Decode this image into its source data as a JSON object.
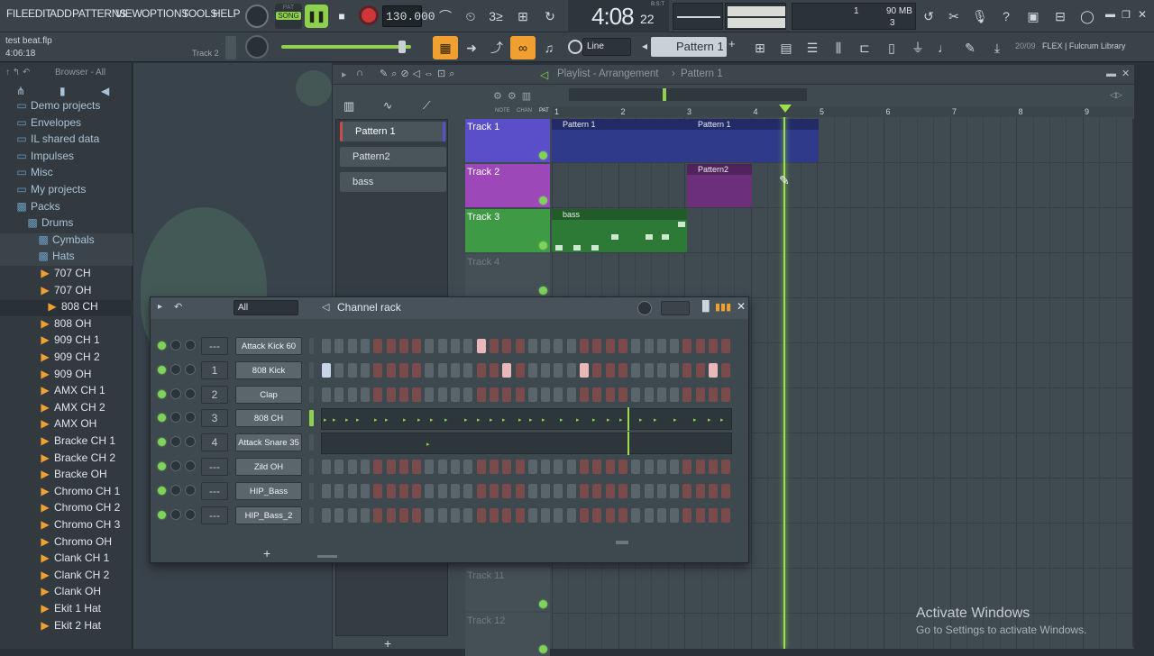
{
  "menu": [
    "FILE",
    "EDIT",
    "ADD",
    "PATTERNS",
    "VIEW",
    "OPTIONS",
    "TOOLS",
    "HELP"
  ],
  "transport": {
    "mode_pat": "PAT",
    "mode_song": "SONG",
    "tempo": "130.000",
    "time": "4:08",
    "time_sub": "22",
    "time_label": "B:S:T"
  },
  "cpu": {
    "channels": "1",
    "memory": "90 MB",
    "polyphony": "3"
  },
  "project": {
    "filename": "test beat.flp",
    "position": "4:06:18",
    "hint_track": "Track 2"
  },
  "toolbar2": {
    "snap": "Line",
    "pattern": "Pattern 1",
    "plus": "+",
    "news": "20/09",
    "news_text": "FLEX | Fulcrum Library"
  },
  "browser": {
    "title": "Browser - All",
    "items": [
      {
        "label": "Demo projects",
        "type": "folder"
      },
      {
        "label": "Envelopes",
        "type": "folder"
      },
      {
        "label": "IL shared data",
        "type": "folder"
      },
      {
        "label": "Impulses",
        "type": "folder"
      },
      {
        "label": "Misc",
        "type": "folder"
      },
      {
        "label": "My projects",
        "type": "folder"
      },
      {
        "label": "Packs",
        "type": "pack"
      },
      {
        "label": "Drums",
        "type": "pack"
      },
      {
        "label": "Cymbals",
        "type": "pack"
      },
      {
        "label": "Hats",
        "type": "pack"
      },
      {
        "label": "707 CH",
        "type": "sample"
      },
      {
        "label": "707 OH",
        "type": "sample"
      },
      {
        "label": "808 CH",
        "type": "sample"
      },
      {
        "label": "808 OH",
        "type": "sample"
      },
      {
        "label": "909 CH 1",
        "type": "sample"
      },
      {
        "label": "909 CH 2",
        "type": "sample"
      },
      {
        "label": "909 OH",
        "type": "sample"
      },
      {
        "label": "AMX CH 1",
        "type": "sample"
      },
      {
        "label": "AMX CH 2",
        "type": "sample"
      },
      {
        "label": "AMX OH",
        "type": "sample"
      },
      {
        "label": "Bracke CH 1",
        "type": "sample"
      },
      {
        "label": "Bracke CH 2",
        "type": "sample"
      },
      {
        "label": "Bracke OH",
        "type": "sample"
      },
      {
        "label": "Chromo CH 1",
        "type": "sample"
      },
      {
        "label": "Chromo CH 2",
        "type": "sample"
      },
      {
        "label": "Chromo CH 3",
        "type": "sample"
      },
      {
        "label": "Chromo OH",
        "type": "sample"
      },
      {
        "label": "Clank CH 1",
        "type": "sample"
      },
      {
        "label": "Clank CH 2",
        "type": "sample"
      },
      {
        "label": "Clank OH",
        "type": "sample"
      },
      {
        "label": "Ekit 1 Hat",
        "type": "sample"
      },
      {
        "label": "Ekit 2 Hat",
        "type": "sample"
      }
    ]
  },
  "playlist": {
    "title": "Playlist - Arrangement",
    "pattern": "Pattern 1",
    "pattern_list": [
      "Pattern 1",
      "Pattern2",
      "bass"
    ],
    "tabs": [
      "NOTE",
      "CHAN",
      "PAT"
    ],
    "bars": [
      "1",
      "2",
      "3",
      "4",
      "5",
      "6",
      "7",
      "8",
      "9"
    ],
    "tracks": [
      {
        "label": "Track 1",
        "color": "#5a4fc9"
      },
      {
        "label": "Track 2",
        "color": "#9c48b8"
      },
      {
        "label": "Track 3",
        "color": "#3e9a45"
      },
      {
        "label": "Track 4",
        "color": ""
      },
      {
        "label": "Track 11",
        "color": ""
      },
      {
        "label": "Track 12",
        "color": ""
      }
    ],
    "clips": [
      "Pattern 1",
      "Pattern 1",
      "Pattern2",
      "bass"
    ]
  },
  "channel_rack": {
    "title": "Channel rack",
    "filter": "All",
    "add": "+",
    "channels": [
      {
        "name": "Attack Kick 60",
        "num": "---",
        "steps": [
          0,
          0,
          0,
          0,
          0,
          0,
          0,
          0,
          0,
          0,
          0,
          0,
          1,
          0,
          0,
          0,
          0,
          0,
          0,
          0,
          0,
          0,
          0,
          0,
          0,
          0,
          0,
          0,
          0,
          0,
          0,
          0
        ],
        "mode": "steps"
      },
      {
        "name": "808 Kick",
        "num": "1",
        "steps": [
          1,
          0,
          0,
          0,
          0,
          0,
          0,
          0,
          0,
          0,
          0,
          0,
          0,
          0,
          1,
          0,
          0,
          0,
          0,
          0,
          1,
          0,
          0,
          0,
          0,
          0,
          0,
          0,
          0,
          0,
          1,
          0
        ],
        "mode": "steps"
      },
      {
        "name": "Clap",
        "num": "2",
        "steps": [
          0,
          0,
          0,
          0,
          0,
          0,
          0,
          0,
          0,
          0,
          0,
          0,
          0,
          0,
          0,
          0,
          0,
          0,
          0,
          0,
          0,
          0,
          0,
          0,
          0,
          0,
          0,
          0,
          0,
          0,
          0,
          0
        ],
        "mode": "steps"
      },
      {
        "name": "808 CH",
        "num": "3",
        "mode": "roll"
      },
      {
        "name": "Attack Snare 35",
        "num": "4",
        "mode": "roll"
      },
      {
        "name": "Zild OH",
        "num": "---",
        "steps": [
          0,
          0,
          0,
          0,
          0,
          0,
          0,
          0,
          0,
          0,
          0,
          0,
          0,
          0,
          0,
          0,
          0,
          0,
          0,
          0,
          0,
          0,
          0,
          0,
          0,
          0,
          0,
          0,
          0,
          0,
          0,
          0
        ],
        "mode": "steps"
      },
      {
        "name": "HIP_Bass",
        "num": "---",
        "steps": [
          0,
          0,
          0,
          0,
          0,
          0,
          0,
          0,
          0,
          0,
          0,
          0,
          0,
          0,
          0,
          0,
          0,
          0,
          0,
          0,
          0,
          0,
          0,
          0,
          0,
          0,
          0,
          0,
          0,
          0,
          0,
          0
        ],
        "mode": "steps"
      },
      {
        "name": "HIP_Bass_2",
        "num": "---",
        "steps": [
          0,
          0,
          0,
          0,
          0,
          0,
          0,
          0,
          0,
          0,
          0,
          0,
          0,
          0,
          0,
          0,
          0,
          0,
          0,
          0,
          0,
          0,
          0,
          0,
          0,
          0,
          0,
          0,
          0,
          0,
          0,
          0
        ],
        "mode": "steps"
      }
    ]
  },
  "watermark": {
    "line1": "Activate Windows",
    "line2": "Go to Settings to activate Windows."
  },
  "colors": {
    "accent_orange": "#f0a030",
    "play_green": "#8fd14f",
    "playhead": "#9be04a",
    "rec_red": "#d0353a"
  }
}
